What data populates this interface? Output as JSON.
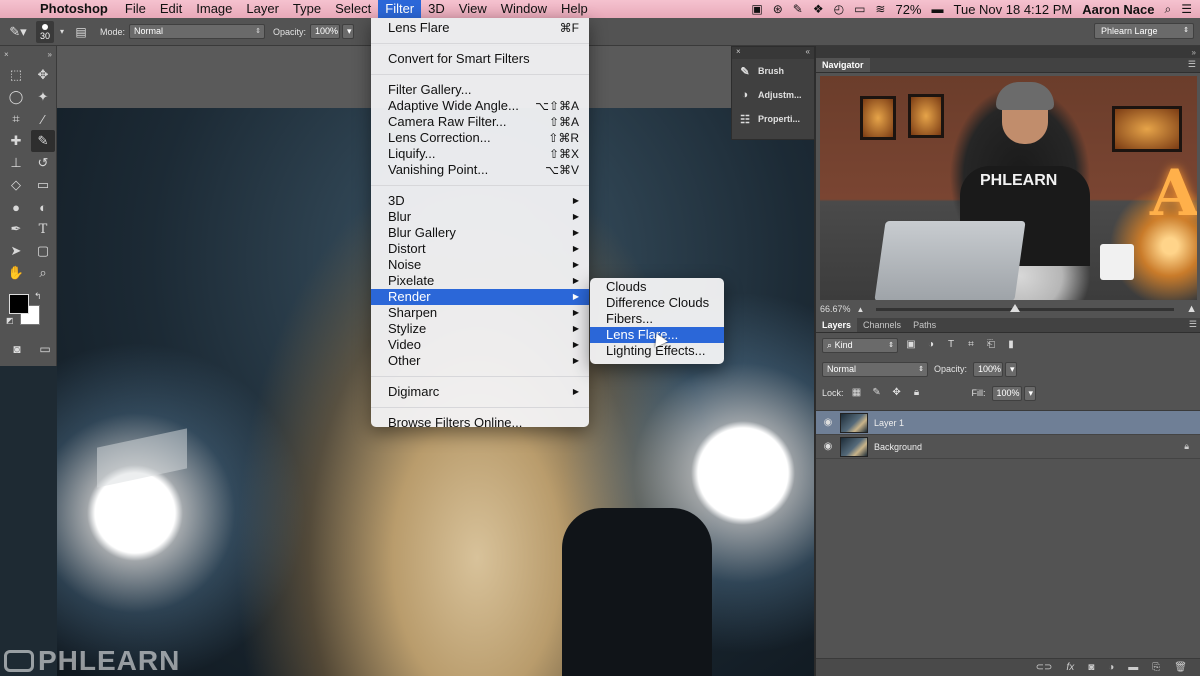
{
  "menubar": {
    "app": "Photoshop",
    "menus": [
      "File",
      "Edit",
      "Image",
      "Layer",
      "Type",
      "Select",
      "Filter",
      "3D",
      "View",
      "Window",
      "Help"
    ],
    "active_menu": "Filter",
    "battery": "72%",
    "datetime": "Tue Nov 18  4:12 PM",
    "user": "Aaron Nace"
  },
  "options": {
    "brush_size": "30",
    "mode_label": "Mode:",
    "mode_value": "Normal",
    "opacity_label": "Opacity:",
    "opacity_value": "100%",
    "workspace": "Phlearn Large"
  },
  "side_panel": {
    "items": [
      "Brush",
      "Adjustm...",
      "Properti..."
    ]
  },
  "navigator": {
    "title": "Navigator",
    "zoom": "66.67%",
    "zoom_slider_fraction": 0.45,
    "preview_text_shirt": "PHLEARN",
    "preview_text_letter": "A"
  },
  "layers": {
    "tabs": [
      "Layers",
      "Channels",
      "Paths"
    ],
    "filter_kind": "Kind",
    "blend_mode": "Normal",
    "opacity_label": "Opacity:",
    "opacity_value": "100%",
    "lock_label": "Lock:",
    "fill_label": "Fill:",
    "fill_value": "100%",
    "items": [
      {
        "name": "Layer 1",
        "selected": true,
        "locked": false
      },
      {
        "name": "Background",
        "selected": false,
        "locked": true
      }
    ]
  },
  "filter_menu": {
    "last_filter": {
      "label": "Lens Flare",
      "shortcut": "⌘F"
    },
    "smart": "Convert for Smart Filters",
    "group1": [
      {
        "label": "Filter Gallery...",
        "shortcut": ""
      },
      {
        "label": "Adaptive Wide Angle...",
        "shortcut": "⌥⇧⌘A"
      },
      {
        "label": "Camera Raw Filter...",
        "shortcut": "⇧⌘A"
      },
      {
        "label": "Lens Correction...",
        "shortcut": "⇧⌘R"
      },
      {
        "label": "Liquify...",
        "shortcut": "⇧⌘X"
      },
      {
        "label": "Vanishing Point...",
        "shortcut": "⌥⌘V"
      }
    ],
    "submenus": [
      "3D",
      "Blur",
      "Blur Gallery",
      "Distort",
      "Noise",
      "Pixelate",
      "Render",
      "Sharpen",
      "Stylize",
      "Video",
      "Other"
    ],
    "highlighted": "Render",
    "digimarc": "Digimarc",
    "browse": "Browse Filters Online..."
  },
  "render_menu": {
    "items": [
      "Clouds",
      "Difference Clouds",
      "Fibers...",
      "Lens Flare...",
      "Lighting Effects..."
    ],
    "highlighted": "Lens Flare..."
  },
  "watermark": "PHLEARN",
  "colors": {
    "menu_highlight": "#2b67d8",
    "menubar": "#f5c2cf",
    "panel_bg": "#535353",
    "selected_layer": "#6f7f96"
  }
}
